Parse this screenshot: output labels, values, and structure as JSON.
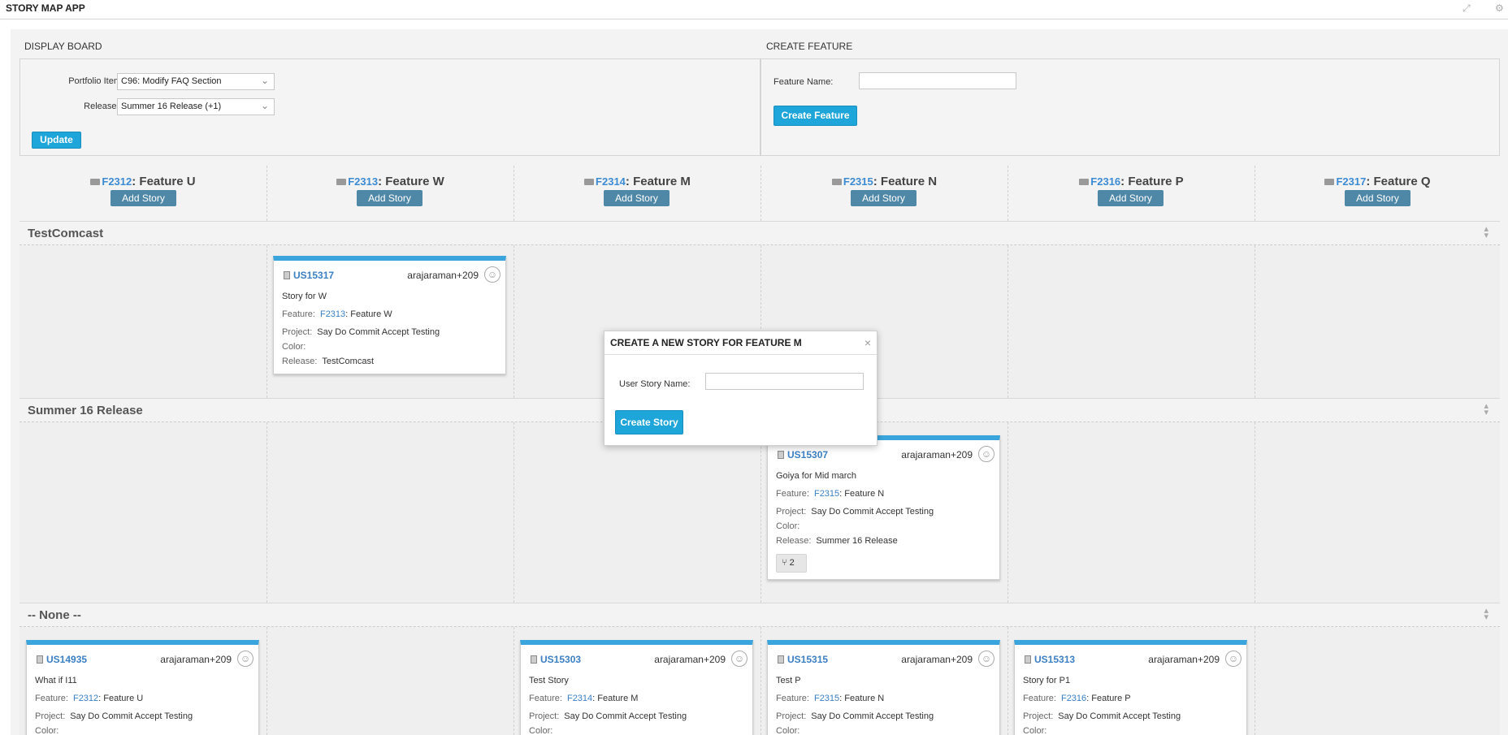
{
  "app": {
    "title": "STORY MAP APP",
    "expand_icon": "expand-icon",
    "settings_icon": "gear-icon"
  },
  "display_board": {
    "title": "DISPLAY BOARD",
    "portfolio_label": "Portfolio Item",
    "portfolio_value": "C96: Modify FAQ Section",
    "releases_label": "Releases",
    "releases_value": "Summer 16 Release (+1)",
    "update_label": "Update"
  },
  "create_feature": {
    "title": "CREATE FEATURE",
    "name_label": "Feature Name:",
    "name_value": "",
    "button_label": "Create Feature"
  },
  "features": [
    {
      "id": "F2312",
      "name": ": Feature U",
      "add_label": "Add Story"
    },
    {
      "id": "F2313",
      "name": ": Feature W",
      "add_label": "Add Story"
    },
    {
      "id": "F2314",
      "name": ": Feature M",
      "add_label": "Add Story"
    },
    {
      "id": "F2315",
      "name": ": Feature N",
      "add_label": "Add Story"
    },
    {
      "id": "F2316",
      "name": ": Feature P",
      "add_label": "Add Story"
    },
    {
      "id": "F2317",
      "name": ": Feature Q",
      "add_label": "Add Story"
    }
  ],
  "swimlanes": [
    "TestComcast",
    "Summer 16 Release",
    "-- None --"
  ],
  "labels": {
    "feature": "Feature:",
    "project": "Project:",
    "color": "Color:",
    "release": "Release:"
  },
  "cards": [
    {
      "id": "US15317",
      "owner": "arajaraman+209",
      "name": "Story for W",
      "feature_id": "F2313",
      "feature_name": ": Feature W",
      "project": "Say Do Commit Accept Testing",
      "color": "",
      "release": "TestComcast"
    },
    {
      "id": "US15307",
      "owner": "arajaraman+209",
      "name": "Goiya for Mid march",
      "feature_id": "F2315",
      "feature_name": ": Feature N",
      "project": "Say Do Commit Accept Testing",
      "color": "",
      "release": "Summer 16 Release",
      "branch_icon": "branch-icon",
      "branch_count": "2"
    },
    {
      "id": "US14935",
      "owner": "arajaraman+209",
      "name": "What if I11",
      "feature_id": "F2312",
      "feature_name": ": Feature U",
      "project": "Say Do Commit Accept Testing",
      "color": ""
    },
    {
      "id": "US15303",
      "owner": "arajaraman+209",
      "name": "Test Story",
      "feature_id": "F2314",
      "feature_name": ": Feature M",
      "project": "Say Do Commit Accept Testing",
      "color": ""
    },
    {
      "id": "US15315",
      "owner": "arajaraman+209",
      "name": "Test P",
      "feature_id": "F2315",
      "feature_name": ": Feature N",
      "project": "Say Do Commit Accept Testing",
      "color": ""
    },
    {
      "id": "US15313",
      "owner": "arajaraman+209",
      "name": "Story for P1",
      "feature_id": "F2316",
      "feature_name": ": Feature P",
      "project": "Say Do Commit Accept Testing",
      "color": ""
    }
  ],
  "modal": {
    "title": "CREATE A NEW STORY FOR FEATURE M",
    "close": "×",
    "name_label": "User Story Name:",
    "name_value": "",
    "button_label": "Create Story"
  }
}
